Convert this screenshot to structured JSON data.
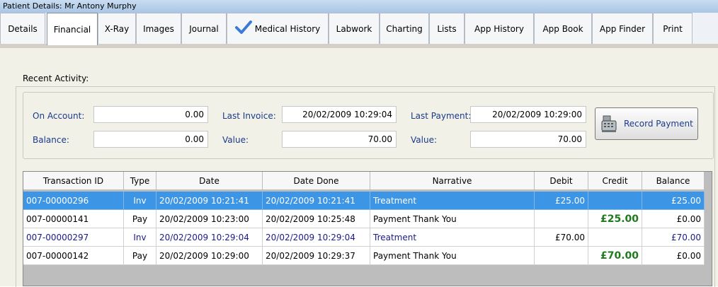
{
  "window": {
    "title": "Patient Details: Mr Antony Murphy"
  },
  "tabs": [
    {
      "label": "Details",
      "active": false
    },
    {
      "label": "Financial",
      "active": true
    },
    {
      "label": "X-Ray",
      "active": false
    },
    {
      "label": "Images",
      "active": false
    },
    {
      "label": "Journal",
      "active": false
    },
    {
      "label": "Medical History",
      "active": false,
      "icon": "checkmark-icon"
    },
    {
      "label": "Labwork",
      "active": false
    },
    {
      "label": "Charting",
      "active": false
    },
    {
      "label": "Lists",
      "active": false
    },
    {
      "label": "App History",
      "active": false
    },
    {
      "label": "App Book",
      "active": false
    },
    {
      "label": "App Finder",
      "active": false
    },
    {
      "label": "Print",
      "active": false
    }
  ],
  "recent_activity": {
    "label": "Recent Activity:",
    "on_account": {
      "label": "On Account:",
      "value": "0.00"
    },
    "balance": {
      "label": "Balance:",
      "value": "0.00"
    },
    "last_invoice": {
      "label": "Last Invoice:",
      "value": "20/02/2009 10:29:04"
    },
    "invoice_value": {
      "label": "Value:",
      "value": "70.00"
    },
    "last_payment": {
      "label": "Last Payment:",
      "value": "20/02/2009 10:29:00"
    },
    "payment_value": {
      "label": "Value:",
      "value": "70.00"
    },
    "record_payment_label": "Record Payment"
  },
  "table": {
    "columns": [
      "Transaction ID",
      "Type",
      "Date",
      "Date Done",
      "Narrative",
      "Debit",
      "Credit",
      "Balance"
    ],
    "rows": [
      {
        "id": "007-00000296",
        "type": "Inv",
        "date": "20/02/2009 10:21:41",
        "date_done": "20/02/2009 10:21:41",
        "narrative": "Treatment",
        "debit": "£25.00",
        "credit": "",
        "balance": "£25.00",
        "selected": true
      },
      {
        "id": "007-00000141",
        "type": "Pay",
        "date": "20/02/2009 10:23:00",
        "date_done": "20/02/2009 10:25:48",
        "narrative": "Payment Thank You",
        "debit": "",
        "credit": "£25.00",
        "balance": "£0.00",
        "selected": false
      },
      {
        "id": "007-00000297",
        "type": "Inv",
        "date": "20/02/2009 10:29:04",
        "date_done": "20/02/2009 10:29:04",
        "narrative": "Treatment",
        "debit": "£70.00",
        "credit": "",
        "balance": "£70.00",
        "selected": false
      },
      {
        "id": "007-00000142",
        "type": "Pay",
        "date": "20/02/2009 10:29:00",
        "date_done": "20/02/2009 10:29:37",
        "narrative": "Payment Thank You",
        "debit": "",
        "credit": "£70.00",
        "balance": "£0.00",
        "selected": false
      }
    ]
  },
  "colors": {
    "selection": "#3d95e6",
    "invoice_text": "#1a1a8a",
    "credit_text": "#1f7a1f",
    "label_text": "#1a3a8a"
  }
}
